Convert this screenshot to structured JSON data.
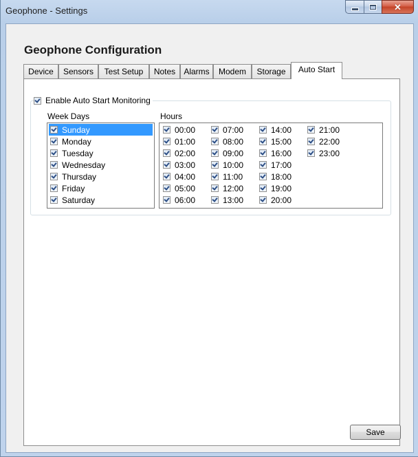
{
  "window": {
    "title": "Geophone - Settings"
  },
  "heading": "Geophone Configuration",
  "tabs": [
    {
      "label": "Device"
    },
    {
      "label": "Sensors"
    },
    {
      "label": "Test Setup"
    },
    {
      "label": "Notes"
    },
    {
      "label": "Alarms"
    },
    {
      "label": "Modem"
    },
    {
      "label": "Storage"
    },
    {
      "label": "Auto Start",
      "active": true
    }
  ],
  "auto_start": {
    "enable_label": "Enable Auto Start Monitoring",
    "enable_checked": true,
    "week_days_label": "Week Days",
    "hours_label": "Hours",
    "week_days": [
      {
        "label": "Sunday",
        "checked": true,
        "selected": true
      },
      {
        "label": "Monday",
        "checked": true
      },
      {
        "label": "Tuesday",
        "checked": true
      },
      {
        "label": "Wednesday",
        "checked": true
      },
      {
        "label": "Thursday",
        "checked": true
      },
      {
        "label": "Friday",
        "checked": true
      },
      {
        "label": "Saturday",
        "checked": true
      }
    ],
    "hours": [
      {
        "label": "00:00",
        "checked": true
      },
      {
        "label": "01:00",
        "checked": true
      },
      {
        "label": "02:00",
        "checked": true
      },
      {
        "label": "03:00",
        "checked": true
      },
      {
        "label": "04:00",
        "checked": true
      },
      {
        "label": "05:00",
        "checked": true
      },
      {
        "label": "06:00",
        "checked": true
      },
      {
        "label": "07:00",
        "checked": true
      },
      {
        "label": "08:00",
        "checked": true
      },
      {
        "label": "09:00",
        "checked": true
      },
      {
        "label": "10:00",
        "checked": true
      },
      {
        "label": "11:00",
        "checked": true
      },
      {
        "label": "12:00",
        "checked": true
      },
      {
        "label": "13:00",
        "checked": true
      },
      {
        "label": "14:00",
        "checked": true
      },
      {
        "label": "15:00",
        "checked": true
      },
      {
        "label": "16:00",
        "checked": true
      },
      {
        "label": "17:00",
        "checked": true
      },
      {
        "label": "18:00",
        "checked": true
      },
      {
        "label": "19:00",
        "checked": true
      },
      {
        "label": "20:00",
        "checked": true
      },
      {
        "label": "21:00",
        "checked": true
      },
      {
        "label": "22:00",
        "checked": true
      },
      {
        "label": "23:00",
        "checked": true
      }
    ]
  },
  "save_label": "Save"
}
